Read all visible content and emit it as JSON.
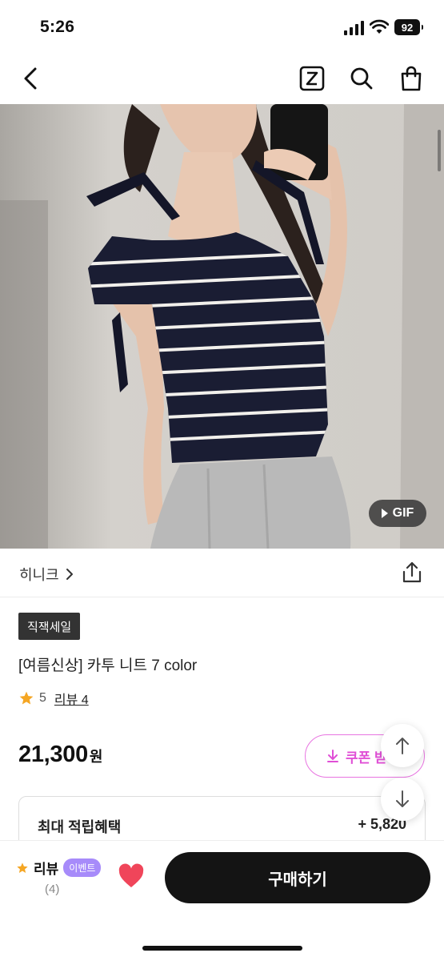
{
  "status_bar": {
    "time": "5:26",
    "battery": "92"
  },
  "nav": {
    "back_icon": "chevron-left-icon",
    "zigzag_icon": "zigzag-z-icon",
    "search_icon": "search-icon",
    "bag_icon": "shopping-bag-icon"
  },
  "hero": {
    "gif_label": "GIF"
  },
  "brand": {
    "name": "히니크",
    "share_icon": "share-icon"
  },
  "product": {
    "badge": "직잭세일",
    "title": "[여름신상] 카투 니트 7 color",
    "rating": "5",
    "review_link": "리뷰 4",
    "price": "21,300",
    "price_unit": "원",
    "coupon_label": "쿠폰 받"
  },
  "benefit": {
    "label": "최대 적립혜택",
    "value": "+ 5,820"
  },
  "bottom": {
    "review_label": "리뷰",
    "event_badge": "이벤트",
    "review_count": "(4)",
    "buy_label": "구매하기"
  },
  "colors": {
    "accent_pink": "#e04fd6",
    "event_purple": "#a78bfa",
    "heart_red": "#f0455a",
    "star": "#f5a623"
  }
}
